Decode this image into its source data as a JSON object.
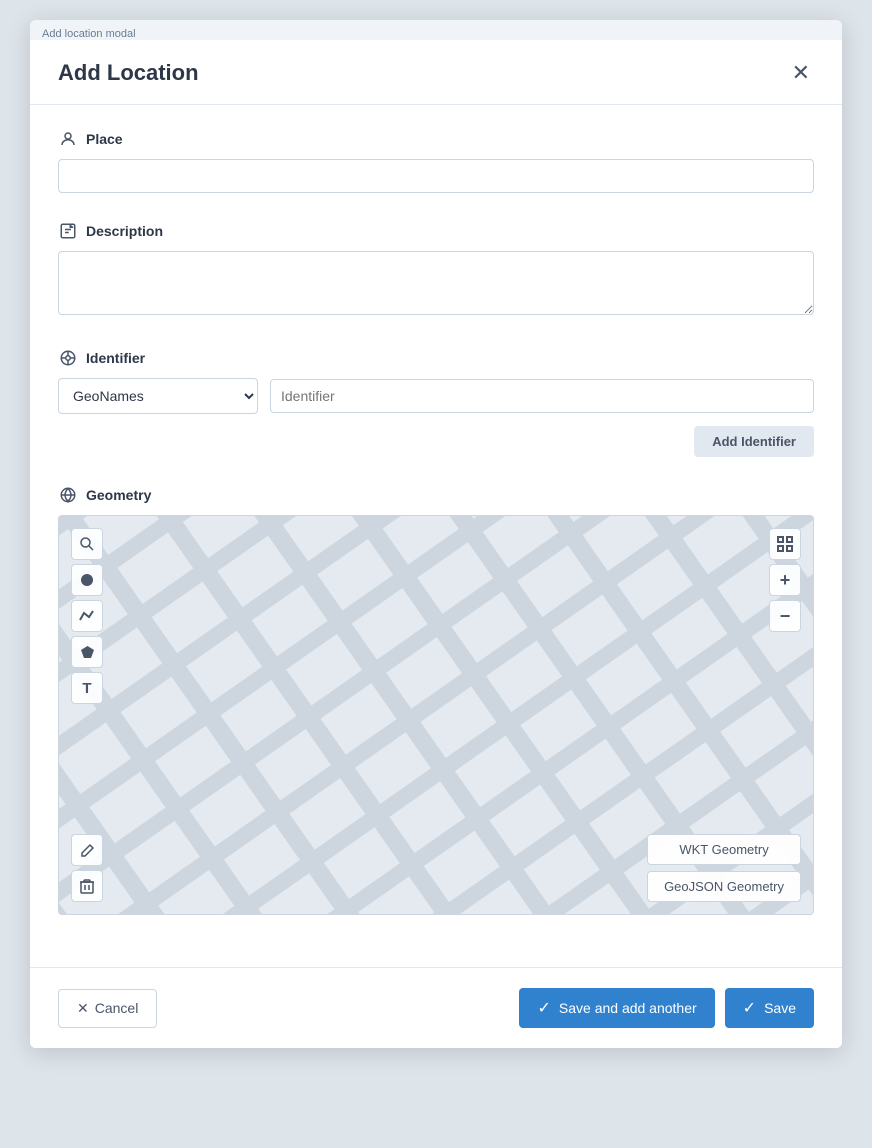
{
  "modal": {
    "outer_label": "Add location modal",
    "title": "Add Location",
    "close_label": "×"
  },
  "fields": {
    "place": {
      "label": "Place",
      "placeholder": ""
    },
    "description": {
      "label": "Description",
      "placeholder": ""
    },
    "identifier": {
      "label": "Identifier",
      "select_options": [
        "GeoNames"
      ],
      "select_value": "GeoNames",
      "input_placeholder": "Identifier",
      "add_button_label": "Add Identifier"
    },
    "geometry": {
      "label": "Geometry",
      "wkt_button": "WKT Geometry",
      "geojson_button": "GeoJSON Geometry"
    }
  },
  "map": {
    "tools": {
      "search": "🔍",
      "point": "●",
      "line": "〜",
      "polygon": "⬠",
      "text": "T",
      "edit": "✎",
      "delete": "🗑"
    },
    "zoom": {
      "expand": "⛶",
      "plus": "+",
      "minus": "−"
    }
  },
  "footer": {
    "cancel_label": "Cancel",
    "save_another_label": "Save and add another",
    "save_label": "Save"
  }
}
